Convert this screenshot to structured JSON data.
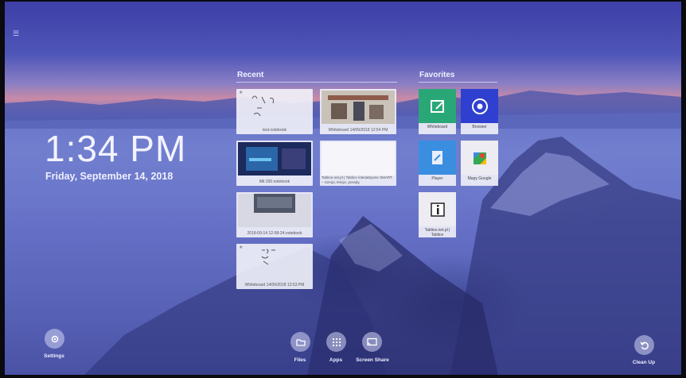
{
  "clock": {
    "time": "1:34 PM",
    "date": "Friday, September 14, 2018"
  },
  "recent": {
    "title": "Recent",
    "items": [
      {
        "caption": "test.notebook"
      },
      {
        "caption": "Whiteboard 14/09/2018 12:54 PM"
      },
      {
        "caption": "Mit 200.notebook"
      },
      {
        "caption": "Tablice.net.pl | Tablice interaktywne SMART – Szmpi, lekcje, porady,"
      },
      {
        "caption": "2018-09-14 12-58-24.notebook"
      },
      {
        "caption": "Whiteboard 14/09/2018 12:53 PM"
      }
    ]
  },
  "favorites": {
    "title": "Favorites",
    "items": [
      {
        "caption": "Whiteboard",
        "icon": "whiteboard-icon",
        "color": "#2aa776"
      },
      {
        "caption": "Browser",
        "icon": "chrome-icon",
        "color": "#2f3fd0"
      },
      {
        "caption": "Player",
        "icon": "player-icon",
        "color": "#3a8ee0"
      },
      {
        "caption": "Mapy Google",
        "icon": "google-maps-icon",
        "color": "#ececf2"
      },
      {
        "caption": "Tablice.net.pl | Tablice",
        "icon": "info-icon",
        "color": "#ececf2"
      }
    ]
  },
  "dock": {
    "settings": "Settings",
    "files": "Files",
    "apps": "Apps",
    "screen_share": "Screen Share",
    "clean_up": "Clean Up"
  }
}
